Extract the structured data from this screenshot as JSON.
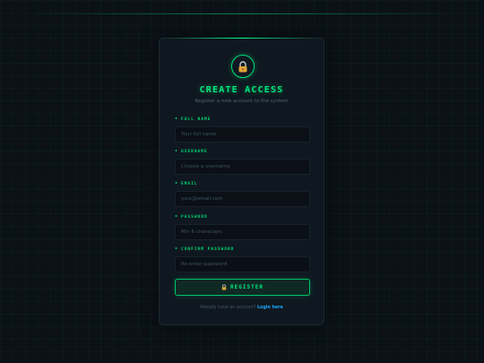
{
  "form": {
    "title": "CREATE ACCESS",
    "subtitle": "Register a new account to the system",
    "lock_icon": "lock-icon",
    "fields": [
      {
        "label": "FULL NAME",
        "placeholder": "Your full name",
        "value": ""
      },
      {
        "label": "USERNAME",
        "placeholder": "Choose a username",
        "value": ""
      },
      {
        "label": "EMAIL",
        "placeholder": "your@email.com",
        "value": ""
      },
      {
        "label": "PASSWORD",
        "placeholder": "Min 6 characters",
        "value": ""
      },
      {
        "label": "CONFIRM PASSWORD",
        "placeholder": "Re-enter password",
        "value": ""
      }
    ],
    "register_label": "REGISTER",
    "footer_text": "Already have an account?",
    "login_link": "Login here"
  },
  "colors": {
    "accent": "#00e87e",
    "background": "#0b1117",
    "card": "#0f1820",
    "link": "#1aa6ff",
    "lock_body": "#e0a53a"
  }
}
